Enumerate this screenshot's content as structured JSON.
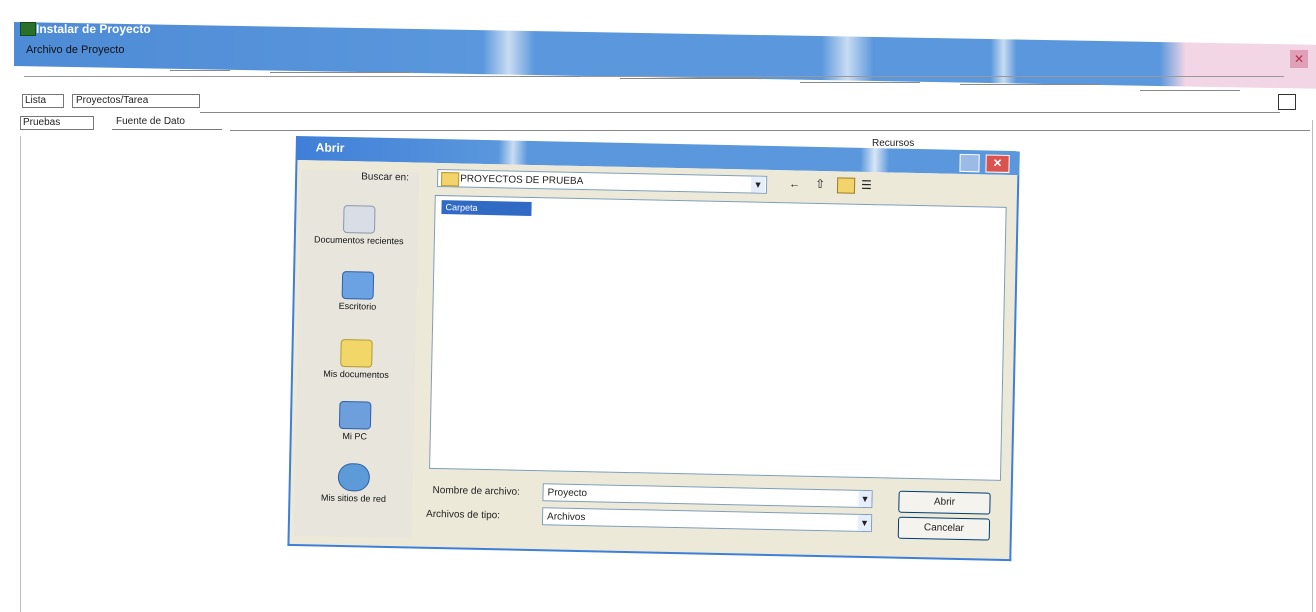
{
  "window": {
    "title": "Instalar de Proyecto"
  },
  "main": {
    "archivo_label": "Archivo de Proyecto",
    "tab_left": "Lista",
    "tab_combo": "Proyectos/Tarea",
    "row2_left": "Pruebas",
    "row2_right": "Fuente de Dato",
    "header_right": "Recursos"
  },
  "dialog": {
    "title": "Abrir",
    "look_in_label": "Buscar en:",
    "look_in_value": "PROYECTOS DE PRUEBA",
    "file_item": "Carpeta",
    "places": [
      {
        "label": "Documentos recientes",
        "icon": "recent-documents-icon"
      },
      {
        "label": "Escritorio",
        "icon": "desktop-icon"
      },
      {
        "label": "Mis documentos",
        "icon": "my-documents-icon"
      },
      {
        "label": "Mi PC",
        "icon": "my-computer-icon"
      },
      {
        "label": "Mis sitios de red",
        "icon": "network-icon"
      }
    ],
    "file_name_label": "Nombre de archivo:",
    "file_name_value": "Proyecto",
    "file_type_label": "Archivos de tipo:",
    "file_type_value": "Archivos",
    "open_button": "Abrir",
    "cancel_button": "Cancelar"
  },
  "colors": {
    "titlebar": "#5a97dc",
    "selection": "#316ac5",
    "dialog_bg": "#ece9d8"
  }
}
